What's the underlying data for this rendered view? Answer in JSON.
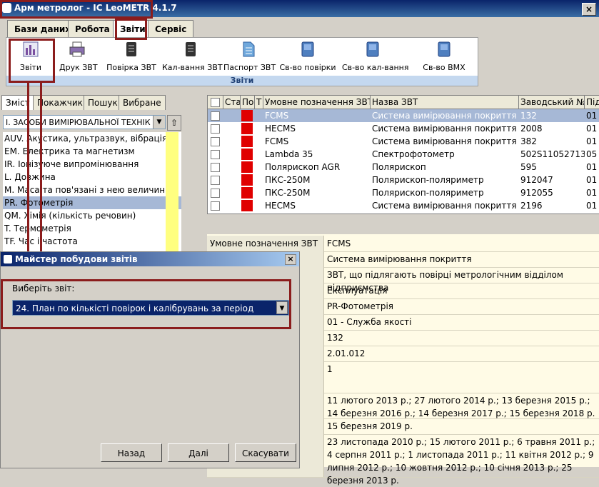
{
  "window": {
    "title": "Арм метролог - IC LeoMETR 4.1.7",
    "close": "×"
  },
  "menu_tabs": [
    "Бази даних",
    "Робота",
    "Звіти",
    "Сервіс"
  ],
  "ribbon": {
    "buttons": [
      "Звіти",
      "Друк ЗВТ",
      "Повірка ЗВТ",
      "Кал-вання ЗВТ",
      "Паспорт ЗВТ",
      "Св-во повірки",
      "Св-во кал-вання",
      "Св-во ВМХ"
    ],
    "group_label": "Звіти"
  },
  "left": {
    "tabs": [
      "Зміст",
      "Покажчик",
      "Пошук",
      "Вибране"
    ],
    "combo_value": "І. ЗАСОБИ ВИМІРЮВАЛЬНОЇ ТЕХНІК",
    "up": "⇧",
    "categories": [
      "AUV. Акустика, ультразвук, вібрація",
      "EM. Електрика та магнетизм",
      "IR. Іонізуюче випромінювання",
      "L. Довжина",
      "M. Маса та пов'язані з нею величини",
      "PR. Фотометрія",
      "QM. Хімія (кількість речовин)",
      "T. Термометрія",
      "TF. Час і частота"
    ]
  },
  "grid": {
    "headers": [
      "Ста",
      "Пов",
      "Т",
      "Умовне позначення ЗВТ",
      "Назва ЗВТ",
      "Заводський №",
      "Під"
    ],
    "rows": [
      [
        "FCMS",
        "Система вимірювання покриття",
        "132",
        "01"
      ],
      [
        "HECMS",
        "Система вимірювання покриття",
        "2008",
        "01"
      ],
      [
        "FCMS",
        "Система вимірювання покриття",
        "382",
        "01"
      ],
      [
        "Lambda 35",
        "Спектрофотометр",
        "502S11052713",
        "05"
      ],
      [
        "Полярископ AGR",
        "Полярископ",
        "595",
        "01"
      ],
      [
        "ПКС-250М",
        "Полярископ-поляриметр",
        "912047",
        "01"
      ],
      [
        "ПКС-250М",
        "Полярископ-поляриметр",
        "912055",
        "01"
      ],
      [
        "HECMS",
        "Система вимірювання покриття",
        "2196",
        "01"
      ]
    ]
  },
  "details": {
    "rows": [
      {
        "label": "Умовне позначення ЗВТ",
        "value": "FCMS"
      },
      {
        "label": "",
        "value": "Система вимірювання покриття"
      },
      {
        "label": "",
        "value": "ЗВТ, що підлягають повірці метрологічним відділом підприємства"
      },
      {
        "label": "",
        "value": "Експлуатація"
      },
      {
        "label": "",
        "value": "PR-Фотометрія"
      },
      {
        "label": "",
        "value": "01 - Служба якості"
      },
      {
        "label": "",
        "value": "132"
      },
      {
        "label": "",
        "value": "2.01.012"
      },
      {
        "label": "",
        "value": "1"
      },
      {
        "label": "",
        "value": "11 лютого 2013 р.; 27 лютого 2014 р.; 13 березня 2015 р.; 14 березня 2016 р.; 14 березня 2017 р.; 15 березня 2018 р."
      },
      {
        "label": "",
        "value": "15 березня 2019 р."
      },
      {
        "label": "",
        "value": "23 листопада 2010 р.; 15 лютого 2011 р.; 6 травня 2011 р.; 4 серпня 2011 р.; 1 листопада 2011 р.; 11 квітня 2012 р.; 9 липня 2012 р.; 10 жовтня 2012 р.; 10 січня 2013 р.; 25 березня 2013 р."
      }
    ]
  },
  "dialog": {
    "title": "Майстер побудови звітів",
    "close": "×",
    "prompt": "Виберіть звіт:",
    "selected": "24. План по кількісті повірок і калібрувань за період",
    "buttons": [
      "Назад",
      "Далі",
      "Скасувати"
    ]
  },
  "colors": {
    "accent_red": "#8b1c1c",
    "status_red": "#e00000",
    "selection": "#0a246a"
  }
}
